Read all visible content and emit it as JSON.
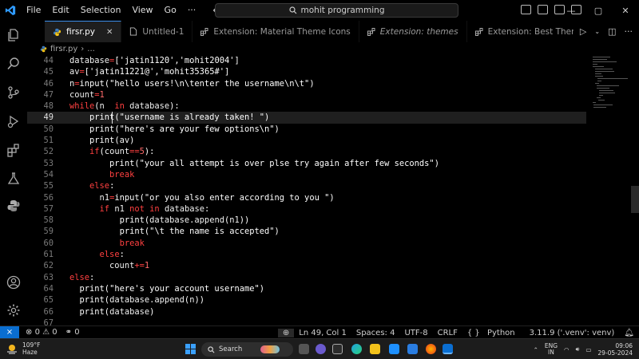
{
  "titlebar": {
    "menu": [
      "File",
      "Edit",
      "Selection",
      "View",
      "Go",
      "···"
    ],
    "search": "mohit programming",
    "controls": [
      "—",
      "▢",
      "✕"
    ]
  },
  "tabs": [
    {
      "label": "firsr.py",
      "active": true,
      "icon": "python-icon"
    },
    {
      "label": "Untitled-1",
      "active": false,
      "icon": "file-icon"
    },
    {
      "label": "Extension: Material Theme Icons",
      "active": false,
      "icon": "extension-icon"
    },
    {
      "label": "Extension: themes",
      "active": false,
      "icon": "extension-icon"
    },
    {
      "label": "Extension: Best Themes Redefined",
      "active": false,
      "icon": "extension-icon"
    }
  ],
  "breadcrumb": {
    "file": "firsr.py",
    "more": "..."
  },
  "code": {
    "current_line": 49,
    "lines": [
      {
        "n": "44",
        "text": "database=['jatin1120','mohit2004']"
      },
      {
        "n": "45",
        "text": "av=['jatin11221@','mohit35365#']"
      },
      {
        "n": "46",
        "text": "n=input(\"hello users!\\n\\tenter the username\\n\\t\")"
      },
      {
        "n": "47",
        "text": "count=1"
      },
      {
        "n": "48",
        "text": "while(n  in database):"
      },
      {
        "n": "49",
        "text": "    print(\"username is already taken! \")"
      },
      {
        "n": "50",
        "text": "    print(\"here's are your few options\\n\")"
      },
      {
        "n": "51",
        "text": "    print(av)"
      },
      {
        "n": "52",
        "text": "    if(count==5):"
      },
      {
        "n": "53",
        "text": "        print(\"your all attempt is over plse try again after few seconds\")"
      },
      {
        "n": "54",
        "text": "        break"
      },
      {
        "n": "55",
        "text": "    else:"
      },
      {
        "n": "56",
        "text": "      n1=input(\"or you also enter according to you \")"
      },
      {
        "n": "57",
        "text": "      if n1 not in database:"
      },
      {
        "n": "58",
        "text": "          print(database.append(n1))"
      },
      {
        "n": "59",
        "text": "          print(\"\\t the name is accepted\")"
      },
      {
        "n": "60",
        "text": "          break"
      },
      {
        "n": "61",
        "text": "      else:"
      },
      {
        "n": "62",
        "text": "        count+=1"
      },
      {
        "n": "63",
        "text": "else:"
      },
      {
        "n": "64",
        "text": "  print(\"here's your account username\")"
      },
      {
        "n": "65",
        "text": "  print(database.append(n))"
      },
      {
        "n": "66",
        "text": "  print(database)"
      },
      {
        "n": "67",
        "text": ""
      }
    ]
  },
  "statusbar": {
    "errors": "0",
    "warnings": "0",
    "ports": "0",
    "position": "Ln 49, Col 1",
    "spaces": "Spaces: 4",
    "encoding": "UTF-8",
    "eol": "CRLF",
    "language": "Python",
    "interpreter": "3.11.9 ('.venv': venv)"
  },
  "taskbar": {
    "temp": "109°F",
    "weather": "Haze",
    "search": "Search",
    "lang_top": "ENG",
    "lang_bottom": "IN",
    "time": "09:06",
    "date": "29-05-2024"
  },
  "colors": {
    "keyword": "#ff4040",
    "accent": "#3b8eea",
    "remote": "#0a6ed1"
  }
}
